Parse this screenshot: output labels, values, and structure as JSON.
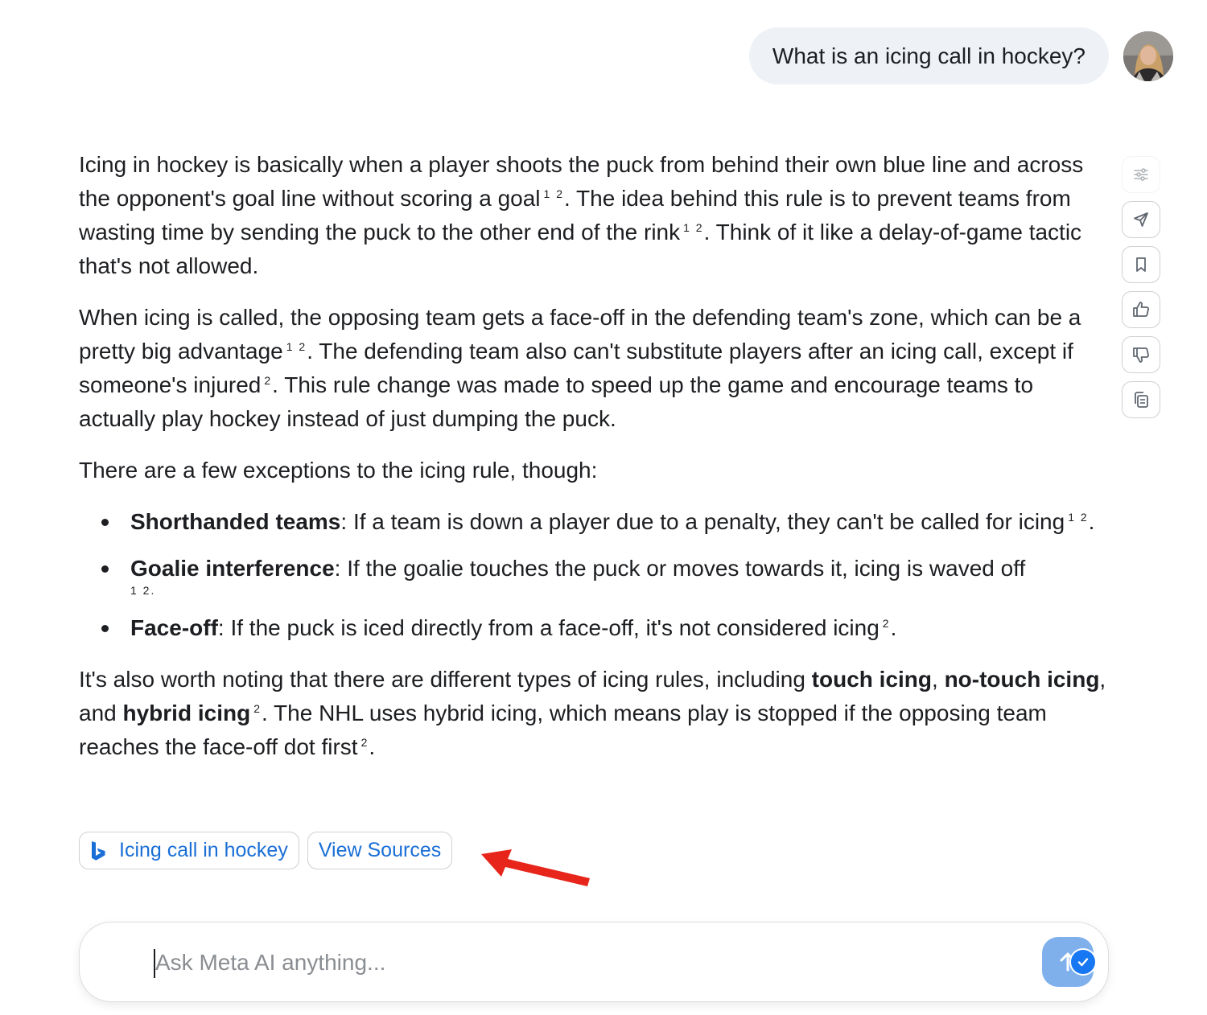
{
  "user_message": {
    "text": "What is an icing call in hockey?"
  },
  "answer": {
    "p1": {
      "t1": "Icing in hockey is basically when a player shoots the puck from behind their own blue line and across the opponent's goal line without scoring a goal",
      "c1": "1 2",
      "t2": ". The idea behind this rule is to prevent teams from wasting time by sending the puck to the other end of the rink",
      "c2": "1 2",
      "t3": ". Think of it like a delay-of-game tactic that's not allowed."
    },
    "p2": {
      "t1": "When icing is called, the opposing team gets a face-off in the defending team's zone, which can be a pretty big advantage",
      "c1": "1 2",
      "t2": ". The defending team also can't substitute players after an icing call, except if someone's injured",
      "c2": "2",
      "t3": ". This rule change was made to speed up the game and encourage teams to actually play hockey instead of just dumping the puck."
    },
    "p3": {
      "text": "There are a few exceptions to the icing rule, though:"
    },
    "exceptions": [
      {
        "term": "Shorthanded teams",
        "desc": ": If a team is down a player due to a penalty, they can't be called for icing",
        "cite": "1 2",
        "end": "."
      },
      {
        "term": "Goalie interference",
        "desc": ": If the goalie touches the puck or moves towards it, icing is waved off",
        "cite": "1 2",
        "end": "."
      },
      {
        "term": "Face-off",
        "desc": ": If the puck is iced directly from a face-off, it's not considered icing",
        "cite": "2",
        "end": "."
      }
    ],
    "p4": {
      "t1": "It's also worth noting that there are different types of icing rules, including ",
      "b1": "touch icing",
      "t2": ", ",
      "b2": "no-touch icing",
      "t3": ", and ",
      "b3": "hybrid icing",
      "c1": "2",
      "t4": ". The NHL uses hybrid icing, which means play is stopped if the opposing team reaches the face-off dot first",
      "c2": "2",
      "t5": "."
    }
  },
  "chips": {
    "search_label": "Icing call in hockey",
    "sources_label": "View Sources"
  },
  "side_actions": [
    "settings-sliders-icon",
    "share-icon",
    "bookmark-icon",
    "thumbs-up-icon",
    "thumbs-down-icon",
    "copy-icon"
  ],
  "composer": {
    "placeholder": "Ask Meta AI anything...",
    "value": ""
  },
  "colors": {
    "accent": "#1a6fd6",
    "send_button": "#7fb0ec",
    "annotation_arrow": "#e8251b",
    "user_bubble": "#eef1f5"
  }
}
